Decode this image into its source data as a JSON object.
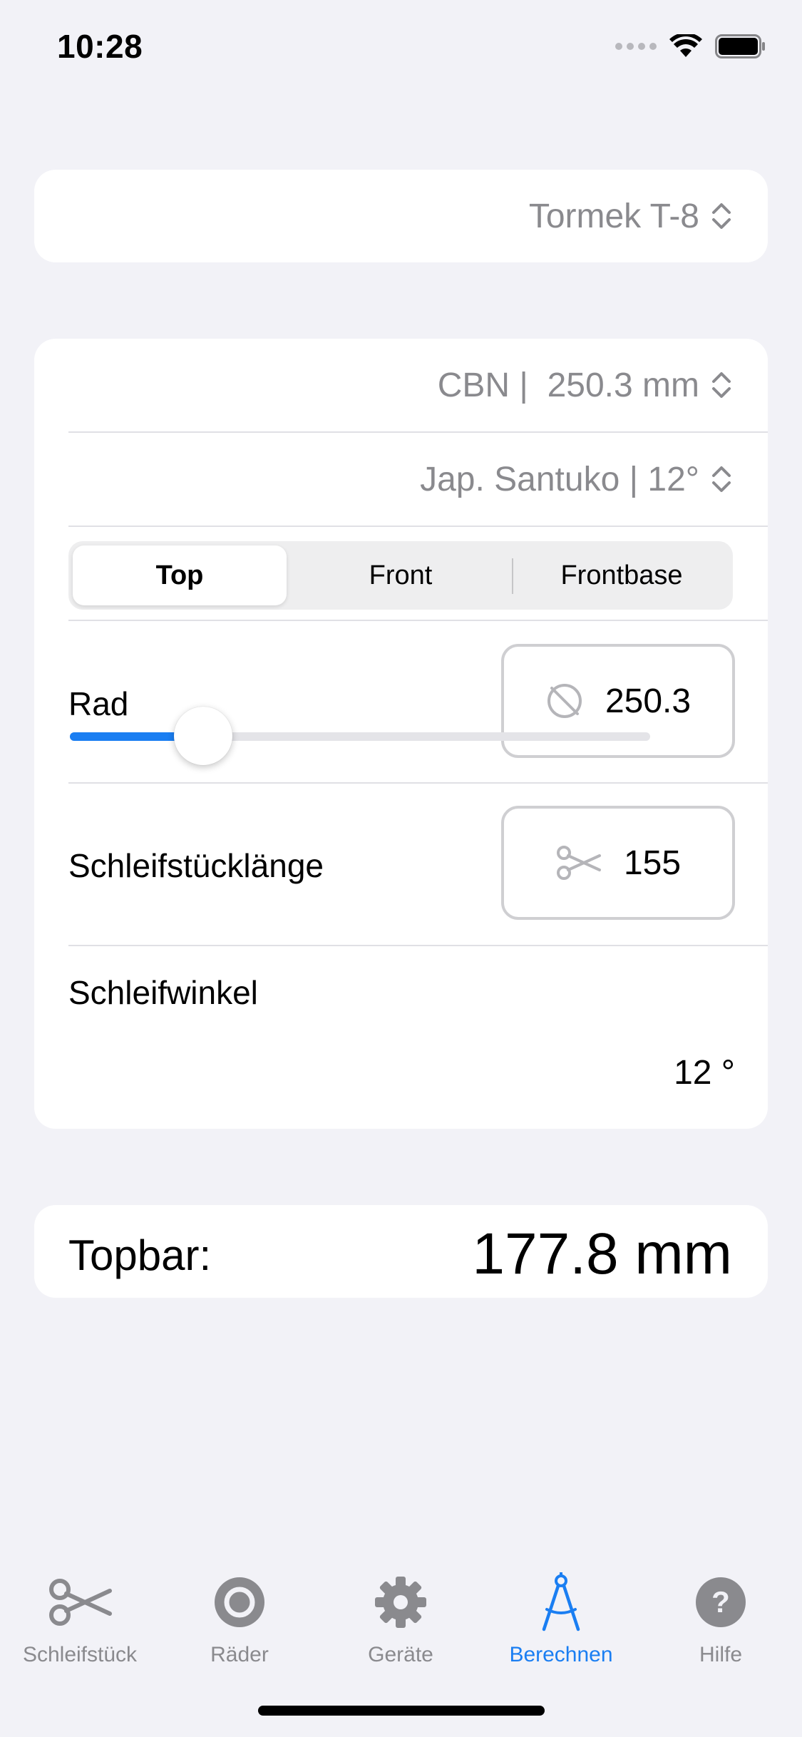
{
  "status": {
    "time": "10:28"
  },
  "device_picker": {
    "value": "Tormek T-8"
  },
  "wheel_picker": {
    "value": "CBN |  250.3 mm"
  },
  "knife_picker": {
    "value": "Jap. Santuko | 12°"
  },
  "segments": {
    "top": "Top",
    "front": "Front",
    "frontbase": "Frontbase",
    "selected": "Top"
  },
  "rad": {
    "label": "Rad",
    "value": "250.3"
  },
  "length": {
    "label": "Schleifstücklänge",
    "value": "155"
  },
  "angle": {
    "label": "Schleifwinkel",
    "value_text": "12 °",
    "fraction": 0.23
  },
  "result": {
    "label": "Topbar:",
    "value": "177.8 mm"
  },
  "tabs": {
    "schleifstueck": "Schleifstück",
    "raeder": "Räder",
    "geraete": "Geräte",
    "berechnen": "Berechnen",
    "hilfe": "Hilfe",
    "active": "Berechnen"
  },
  "colors": {
    "accent": "#1a7ef2",
    "secondary_text": "#8a8a8e",
    "background": "#f2f2f7"
  },
  "icons": {
    "rad_field": "wheel-slash-icon",
    "length_field": "scissors-icon",
    "tab_schleifstueck": "scissors-icon",
    "tab_raeder": "circle-icon",
    "tab_geraete": "gear-icon",
    "tab_berechnen": "compass-icon",
    "tab_hilfe": "question-icon"
  }
}
